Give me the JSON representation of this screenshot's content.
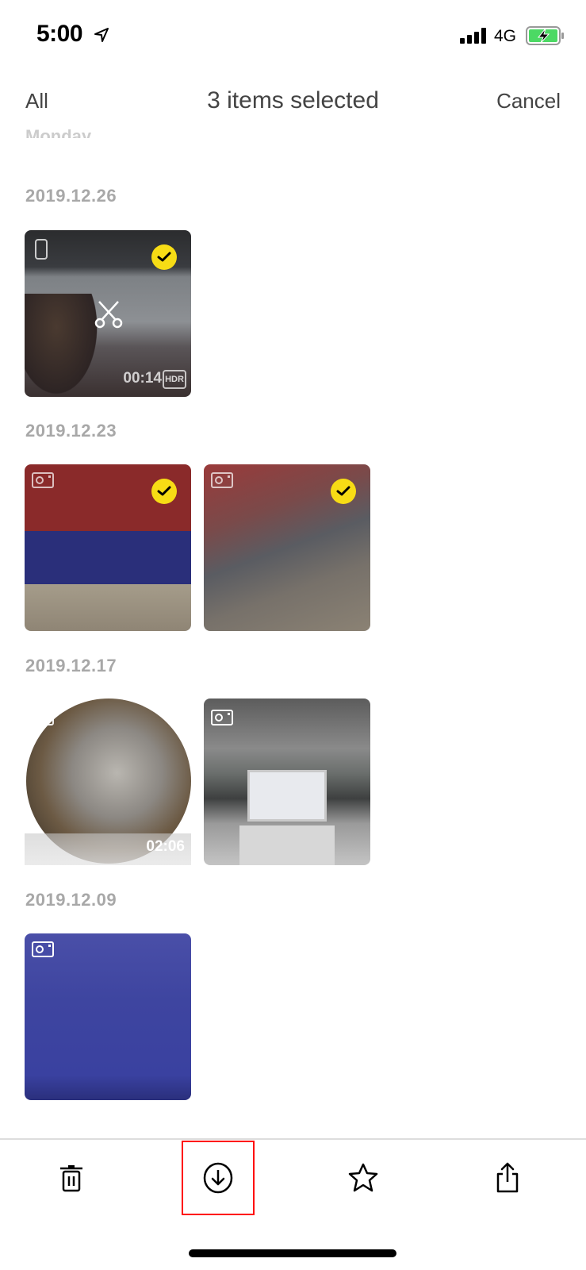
{
  "status_bar": {
    "time": "5:00",
    "network": "4G",
    "icons": [
      "location-arrow-icon",
      "signal-icon",
      "battery-charging-icon"
    ]
  },
  "nav": {
    "left_label": "All",
    "title": "3 items selected",
    "right_label": "Cancel"
  },
  "faded_header": "Monday",
  "groups": [
    {
      "date": "2019.12.26",
      "items": [
        {
          "type": "video",
          "source_icon": "phone-icon",
          "selected": true,
          "duration": "00:14",
          "hdr": "HDR",
          "edit_icon": "scissors-icon"
        }
      ]
    },
    {
      "date": "2019.12.23",
      "items": [
        {
          "type": "photo",
          "source_icon": "camera-icon",
          "selected": true
        },
        {
          "type": "photo",
          "source_icon": "camera-icon",
          "selected": true
        }
      ]
    },
    {
      "date": "2019.12.17",
      "items": [
        {
          "type": "video-360",
          "source_icon": "camera-icon",
          "selected": false,
          "duration": "02:06"
        },
        {
          "type": "photo",
          "source_icon": "camera-icon",
          "selected": false
        }
      ]
    },
    {
      "date": "2019.12.09",
      "items": [
        {
          "type": "photo",
          "source_icon": "camera-icon",
          "selected": false
        }
      ]
    }
  ],
  "toolbar": {
    "items": [
      {
        "name": "delete",
        "icon": "trash-icon"
      },
      {
        "name": "download",
        "icon": "download-circle-icon",
        "highlighted": true
      },
      {
        "name": "favorite",
        "icon": "star-icon"
      },
      {
        "name": "share",
        "icon": "share-icon"
      }
    ]
  },
  "colors": {
    "selection_badge": "#f7dc15",
    "highlight_box": "#ff0000",
    "date_label": "#a8a8a8",
    "nav_text": "#444444",
    "battery_fill": "#4cd964"
  }
}
